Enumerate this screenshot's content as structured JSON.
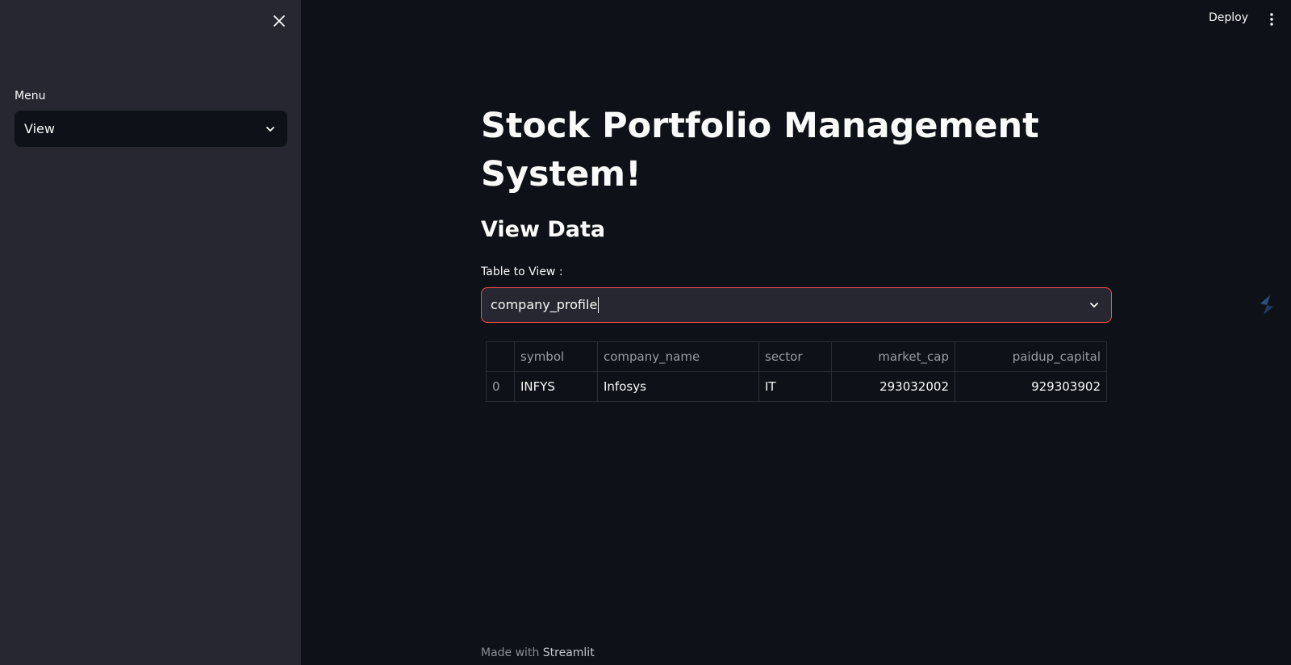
{
  "header": {
    "deploy_label": "Deploy"
  },
  "sidebar": {
    "menu_label": "Menu",
    "menu_selected": "View"
  },
  "main": {
    "title": "Stock Portfolio Management System!",
    "subtitle": "View Data",
    "table_select_label": "Table to View :",
    "table_select_value": "company_profile"
  },
  "dataframe": {
    "columns": [
      "",
      "symbol",
      "company_name",
      "sector",
      "market_cap",
      "paidup_capital"
    ],
    "rows": [
      {
        "index": "0",
        "symbol": "INFYS",
        "company_name": "Infosys",
        "sector": "IT",
        "market_cap": "293032002",
        "paidup_capital": "929303902"
      }
    ]
  },
  "footer": {
    "prefix": "Made with",
    "brand": "Streamlit"
  },
  "colors": {
    "accent": "#ff4b4b",
    "sidebar_bg": "#262730",
    "main_bg": "#0e1117"
  }
}
